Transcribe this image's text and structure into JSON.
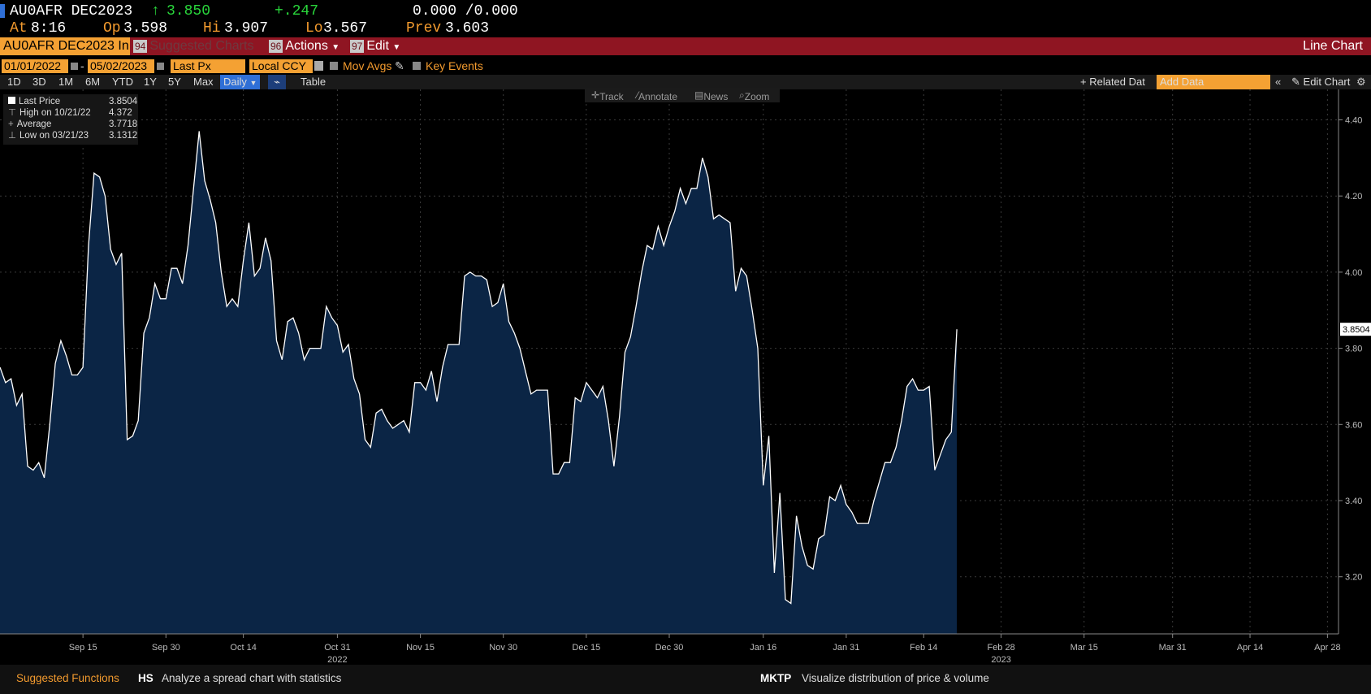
{
  "header": {
    "symbol": "AU0AFR DEC2023",
    "arrow": "↑",
    "price": "3.850",
    "change": "+.247",
    "bid_ask": "0.000 /0.000",
    "at_label": "At",
    "at_value": "8:16",
    "open_label": "Op",
    "open_value": "3.598",
    "high_label": "Hi",
    "high_value": "3.907",
    "low_label": "Lo",
    "low_value": "3.567",
    "prev_label": "Prev",
    "prev_value": "3.603",
    "accent_color": "#29d63b"
  },
  "menubar": {
    "security_tab": "AU0AFR DEC2023 In",
    "suggested_num": "94",
    "suggested_label": "Suggested Charts",
    "actions_num": "96",
    "actions_label": "Actions",
    "edit_num": "97",
    "edit_label": "Edit",
    "chart_type_label": "Line Chart"
  },
  "controls": {
    "start_date": "01/01/2022",
    "separator": "-",
    "end_date": "05/02/2023",
    "field": "Last Px",
    "currency": "Local CCY",
    "mov_avgs": "Mov Avgs",
    "key_events": "Key Events"
  },
  "range_bar": {
    "ranges": [
      "1D",
      "3D",
      "1M",
      "6M",
      "YTD",
      "1Y",
      "5Y",
      "Max"
    ],
    "frequency": "Daily",
    "table": "Table",
    "related": "+ Related Dat",
    "add_data_placeholder": "Add Data",
    "edit_chart": "Edit Chart"
  },
  "toolbar": {
    "track": "Track",
    "annotate": "Annotate",
    "news": "News",
    "zoom": "Zoom"
  },
  "legend": {
    "last_label": "Last Price",
    "last_value": "3.8504",
    "high_label": "High on 10/21/22",
    "high_value": "4.372",
    "avg_label": "Average",
    "avg_value": "3.7718",
    "low_label": "Low on 03/21/23",
    "low_value": "3.1312"
  },
  "footer": {
    "suggested": "Suggested Functions",
    "f1_code": "HS",
    "f1_desc": "Analyze a spread chart with statistics",
    "f2_code": "MKTP",
    "f2_desc": "Visualize distribution of price & volume"
  },
  "chart_data": {
    "type": "area",
    "line_color": "#ffffff",
    "fill_color": "#0b2545",
    "ylim": [
      3.05,
      4.48
    ],
    "y_ticks": [
      "3.20",
      "3.40",
      "3.60",
      "3.80",
      "4.00",
      "4.20",
      "4.40"
    ],
    "x_ticks": [
      {
        "label": "Sep 15",
        "t": 10
      },
      {
        "label": "Sep 30",
        "t": 25
      },
      {
        "label": "Oct 14",
        "t": 39
      },
      {
        "label": "Oct 31",
        "t": 56
      },
      {
        "label": "Nov 15",
        "t": 71
      },
      {
        "label": "Nov 30",
        "t": 86
      },
      {
        "label": "Dec 15",
        "t": 101
      },
      {
        "label": "Dec 30",
        "t": 116
      },
      {
        "label": "Jan 16",
        "t": 133
      },
      {
        "label": "Jan 31",
        "t": 148
      },
      {
        "label": "Feb 14",
        "t": 162
      },
      {
        "label": "Feb 28",
        "t": 176
      },
      {
        "label": "Mar 15",
        "t": 191
      },
      {
        "label": "Mar 31",
        "t": 207
      },
      {
        "label": "Apr 14",
        "t": 221
      },
      {
        "label": "Apr 28",
        "t": 235
      }
    ],
    "x_span": [
      -5,
      237
    ],
    "year_labels": [
      {
        "label": "2022",
        "t": 56
      },
      {
        "label": "2023",
        "t": 176
      }
    ],
    "last_value_label": "3.8504",
    "series": [
      {
        "points": [
          [
            -5,
            3.75
          ],
          [
            -4,
            3.71
          ],
          [
            -3,
            3.72
          ],
          [
            -2,
            3.65
          ],
          [
            -1,
            3.68
          ],
          [
            0,
            3.49
          ],
          [
            1,
            3.48
          ],
          [
            2,
            3.5
          ],
          [
            3,
            3.46
          ],
          [
            4,
            3.6
          ],
          [
            5,
            3.76
          ],
          [
            6,
            3.82
          ],
          [
            7,
            3.78
          ],
          [
            8,
            3.73
          ],
          [
            9,
            3.73
          ],
          [
            10,
            3.75
          ],
          [
            11,
            4.07
          ],
          [
            12,
            4.26
          ],
          [
            13,
            4.25
          ],
          [
            14,
            4.2
          ],
          [
            15,
            4.06
          ],
          [
            16,
            4.02
          ],
          [
            17,
            4.05
          ],
          [
            18,
            3.56
          ],
          [
            19,
            3.57
          ],
          [
            20,
            3.61
          ],
          [
            21,
            3.84
          ],
          [
            22,
            3.88
          ],
          [
            23,
            3.97
          ],
          [
            24,
            3.93
          ],
          [
            25,
            3.93
          ],
          [
            26,
            4.01
          ],
          [
            27,
            4.01
          ],
          [
            28,
            3.97
          ],
          [
            29,
            4.07
          ],
          [
            30,
            4.22
          ],
          [
            31,
            4.37
          ],
          [
            32,
            4.24
          ],
          [
            33,
            4.19
          ],
          [
            34,
            4.13
          ],
          [
            35,
            4.0
          ],
          [
            36,
            3.91
          ],
          [
            37,
            3.93
          ],
          [
            38,
            3.91
          ],
          [
            39,
            4.03
          ],
          [
            40,
            4.13
          ],
          [
            41,
            3.99
          ],
          [
            42,
            4.01
          ],
          [
            43,
            4.09
          ],
          [
            44,
            4.03
          ],
          [
            45,
            3.82
          ],
          [
            46,
            3.77
          ],
          [
            47,
            3.87
          ],
          [
            48,
            3.88
          ],
          [
            49,
            3.84
          ],
          [
            50,
            3.77
          ],
          [
            51,
            3.8
          ],
          [
            52,
            3.8
          ],
          [
            53,
            3.8
          ],
          [
            54,
            3.91
          ],
          [
            55,
            3.88
          ],
          [
            56,
            3.86
          ],
          [
            57,
            3.79
          ],
          [
            58,
            3.81
          ],
          [
            59,
            3.72
          ],
          [
            60,
            3.68
          ],
          [
            61,
            3.56
          ],
          [
            62,
            3.54
          ],
          [
            63,
            3.63
          ],
          [
            64,
            3.64
          ],
          [
            65,
            3.61
          ],
          [
            66,
            3.59
          ],
          [
            67,
            3.6
          ],
          [
            68,
            3.61
          ],
          [
            69,
            3.58
          ],
          [
            70,
            3.71
          ],
          [
            71,
            3.71
          ],
          [
            72,
            3.69
          ],
          [
            73,
            3.74
          ],
          [
            74,
            3.66
          ],
          [
            75,
            3.75
          ],
          [
            76,
            3.81
          ],
          [
            77,
            3.81
          ],
          [
            78,
            3.81
          ],
          [
            79,
            3.99
          ],
          [
            80,
            4.0
          ],
          [
            81,
            3.99
          ],
          [
            82,
            3.99
          ],
          [
            83,
            3.98
          ],
          [
            84,
            3.91
          ],
          [
            85,
            3.92
          ],
          [
            86,
            3.97
          ],
          [
            87,
            3.87
          ],
          [
            88,
            3.84
          ],
          [
            89,
            3.8
          ],
          [
            90,
            3.74
          ],
          [
            91,
            3.68
          ],
          [
            92,
            3.69
          ],
          [
            93,
            3.69
          ],
          [
            94,
            3.69
          ],
          [
            95,
            3.47
          ],
          [
            96,
            3.47
          ],
          [
            97,
            3.5
          ],
          [
            98,
            3.5
          ],
          [
            99,
            3.67
          ],
          [
            100,
            3.66
          ],
          [
            101,
            3.71
          ],
          [
            102,
            3.69
          ],
          [
            103,
            3.67
          ],
          [
            104,
            3.7
          ],
          [
            105,
            3.61
          ],
          [
            106,
            3.49
          ],
          [
            107,
            3.62
          ],
          [
            108,
            3.79
          ],
          [
            109,
            3.83
          ],
          [
            110,
            3.91
          ],
          [
            111,
            4.0
          ],
          [
            112,
            4.07
          ],
          [
            113,
            4.06
          ],
          [
            114,
            4.12
          ],
          [
            115,
            4.07
          ],
          [
            116,
            4.12
          ],
          [
            117,
            4.16
          ],
          [
            118,
            4.22
          ],
          [
            119,
            4.18
          ],
          [
            120,
            4.22
          ],
          [
            121,
            4.22
          ],
          [
            122,
            4.3
          ],
          [
            123,
            4.25
          ],
          [
            124,
            4.14
          ],
          [
            125,
            4.15
          ],
          [
            126,
            4.14
          ],
          [
            127,
            4.13
          ],
          [
            128,
            3.95
          ],
          [
            129,
            4.01
          ],
          [
            130,
            3.99
          ],
          [
            131,
            3.9
          ],
          [
            132,
            3.8
          ],
          [
            133,
            3.44
          ],
          [
            134,
            3.57
          ],
          [
            135,
            3.21
          ],
          [
            136,
            3.42
          ],
          [
            137,
            3.14
          ],
          [
            138,
            3.13
          ],
          [
            139,
            3.36
          ],
          [
            140,
            3.28
          ],
          [
            141,
            3.23
          ],
          [
            142,
            3.22
          ],
          [
            143,
            3.3
          ],
          [
            144,
            3.31
          ],
          [
            145,
            3.41
          ],
          [
            146,
            3.4
          ],
          [
            147,
            3.44
          ],
          [
            148,
            3.39
          ],
          [
            149,
            3.37
          ],
          [
            150,
            3.34
          ],
          [
            151,
            3.34
          ],
          [
            152,
            3.34
          ],
          [
            153,
            3.4
          ],
          [
            154,
            3.45
          ],
          [
            155,
            3.5
          ],
          [
            156,
            3.5
          ],
          [
            157,
            3.54
          ],
          [
            158,
            3.61
          ],
          [
            159,
            3.7
          ],
          [
            160,
            3.72
          ],
          [
            161,
            3.69
          ],
          [
            162,
            3.69
          ],
          [
            163,
            3.7
          ],
          [
            164,
            3.48
          ],
          [
            165,
            3.52
          ],
          [
            166,
            3.56
          ],
          [
            167,
            3.58
          ],
          [
            168,
            3.85
          ]
        ]
      }
    ]
  }
}
